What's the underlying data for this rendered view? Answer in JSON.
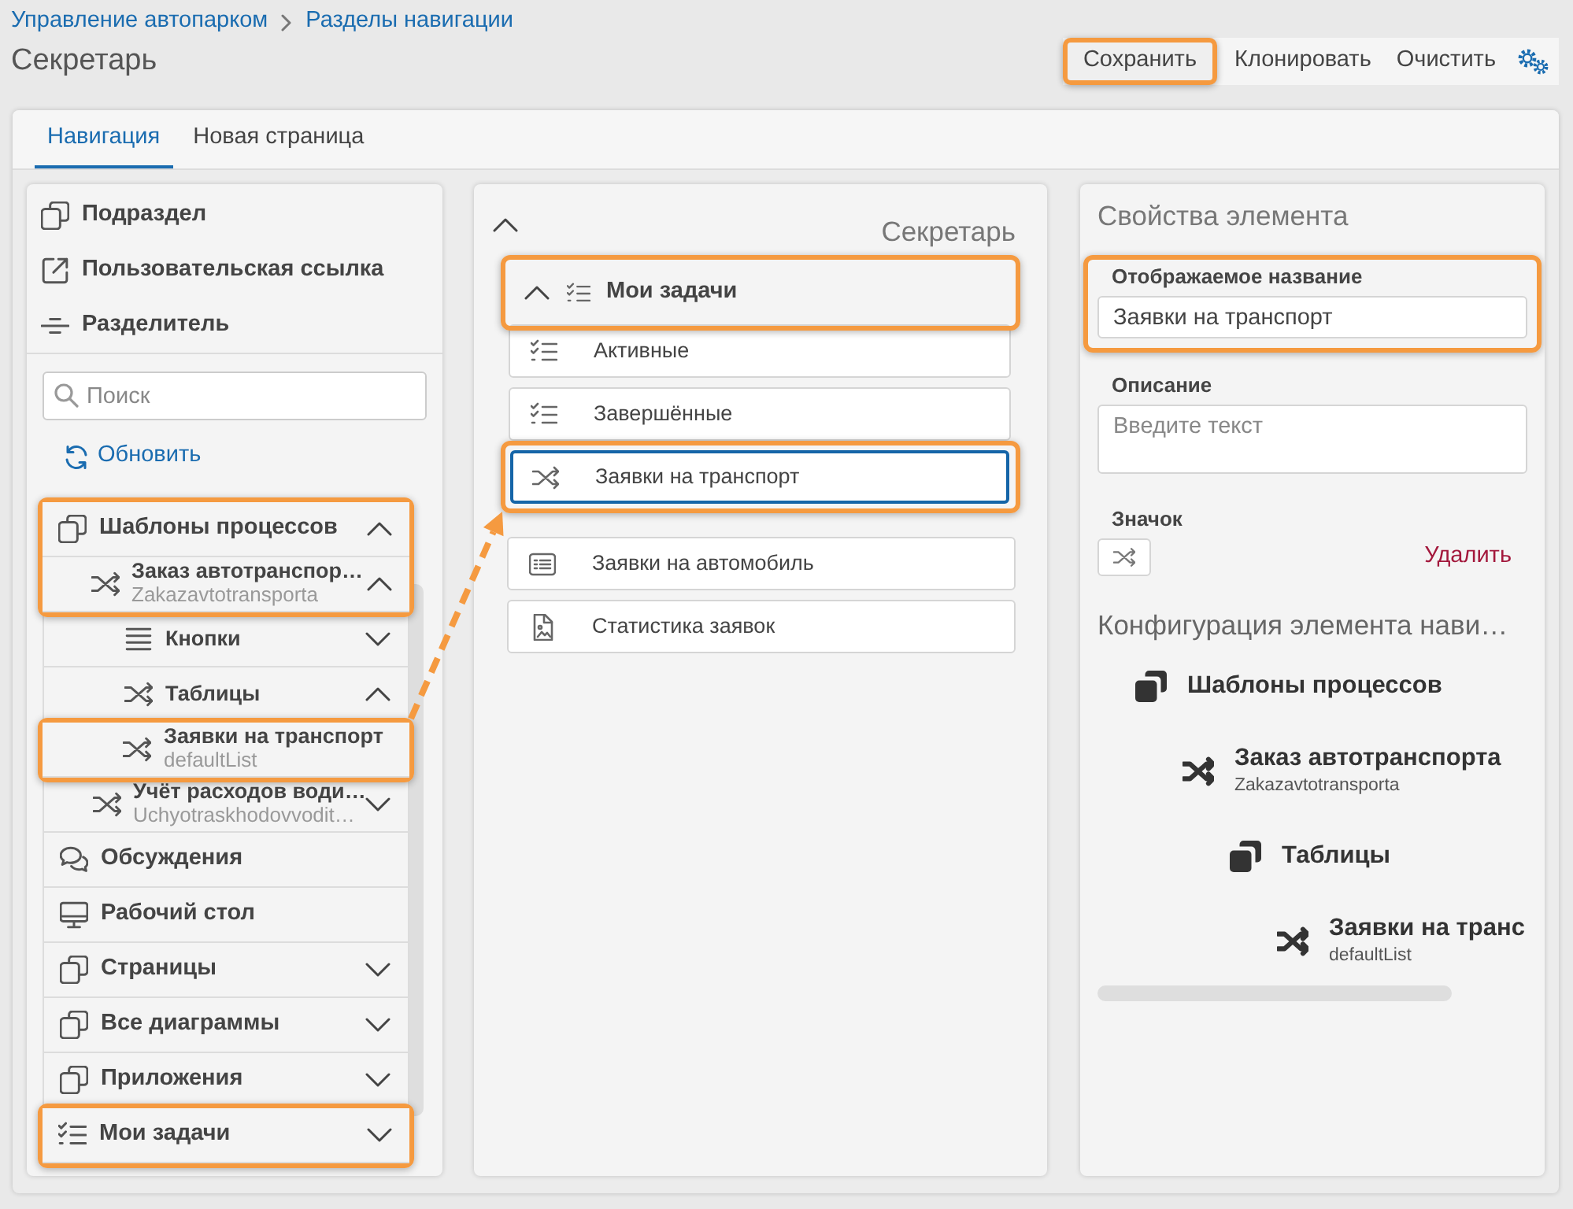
{
  "breadcrumb": [
    {
      "label": "Управление автопарком"
    },
    {
      "label": "Разделы навигации"
    }
  ],
  "page_title": "Секретарь",
  "toolbar": [
    {
      "label": "Сохранить",
      "highlighted": true
    },
    {
      "label": "Клонировать",
      "highlighted": false
    },
    {
      "label": "Очистить",
      "highlighted": false
    }
  ],
  "tabs": [
    {
      "label": "Навигация",
      "selected": true
    },
    {
      "label": "Новая страница",
      "selected": false
    }
  ],
  "left_panel": {
    "add_items": [
      {
        "kind": "section",
        "label": "Подраздел"
      },
      {
        "kind": "link",
        "label": "Пользовательская ссылка"
      },
      {
        "kind": "divider",
        "label": "Разделитель"
      }
    ],
    "search": {
      "placeholder": "Поиск"
    },
    "refresh": "Обновить",
    "tree": [
      {
        "kind": "section",
        "label": "Шаблоны процессов",
        "expanded": true,
        "highlighted": true,
        "children": [
          {
            "kind": "process",
            "label": "Заказ автотранспор…",
            "subtitle": "Zakazavtotransporta",
            "expanded": true,
            "highlighted": true,
            "children": [
              {
                "kind": "list",
                "label": "Кнопки",
                "expanded": false,
                "highlighted": false
              },
              {
                "kind": "process",
                "label": "Таблицы",
                "expanded": true,
                "highlighted": false,
                "children": [
                  {
                    "kind": "process",
                    "label": "Заявки на транспорт",
                    "subtitle": "defaultList",
                    "highlighted": true,
                    "arrow_source": true
                  }
                ]
              }
            ]
          },
          {
            "kind": "process",
            "label": "Учёт расходов води…",
            "subtitle": "Uchyotraskhodovvodit…",
            "expanded": false,
            "highlighted": false
          }
        ]
      },
      {
        "kind": "chat",
        "label": "Обсуждения",
        "highlighted": false
      },
      {
        "kind": "desktop",
        "label": "Рабочий стол",
        "highlighted": false
      },
      {
        "kind": "section",
        "label": "Страницы",
        "expanded": false,
        "highlighted": false
      },
      {
        "kind": "section",
        "label": "Все диаграммы",
        "expanded": false,
        "highlighted": false
      },
      {
        "kind": "section",
        "label": "Приложения",
        "expanded": false,
        "highlighted": false
      },
      {
        "kind": "tasks",
        "label": "Мои задачи",
        "expanded": false,
        "highlighted": true
      }
    ]
  },
  "middle_panel": {
    "title": "Секретарь",
    "expanded": true,
    "items": [
      {
        "kind": "tasks",
        "label": "Мои задачи",
        "expanded": true,
        "highlighted": true,
        "children": [
          {
            "kind": "tasks",
            "label": "Активные",
            "selected": false,
            "highlighted": false
          },
          {
            "kind": "tasks",
            "label": "Завершённые",
            "selected": false,
            "highlighted": false
          },
          {
            "kind": "process",
            "label": "Заявки на транспорт",
            "selected": true,
            "highlighted": true,
            "arrow_target": true
          }
        ]
      },
      {
        "kind": "table",
        "label": "Заявки на автомобиль",
        "selected": false,
        "highlighted": false
      },
      {
        "kind": "report",
        "label": "Статистика заявок",
        "selected": false,
        "highlighted": false
      }
    ]
  },
  "properties": {
    "title": "Свойства элемента",
    "display_name": {
      "label": "Отображаемое название",
      "value": "Заявки на транспорт",
      "highlighted": true
    },
    "description": {
      "label": "Описание",
      "placeholder": "Введите текст"
    },
    "icon": {
      "label": "Значок",
      "kind": "process",
      "remove": "Удалить"
    },
    "configuration": {
      "title": "Конфигурация элемента нави…",
      "tree": [
        {
          "kind": "section",
          "label": "Шаблоны процессов",
          "children": [
            {
              "kind": "process",
              "label": "Заказ автотранспорта",
              "subtitle": "Zakazavtotransporta",
              "children": [
                {
                  "kind": "section",
                  "label": "Таблицы",
                  "children": [
                    {
                      "kind": "process",
                      "label": "Заявки на транс",
                      "subtitle": "defaultList"
                    }
                  ]
                }
              ]
            }
          ]
        }
      ]
    }
  }
}
